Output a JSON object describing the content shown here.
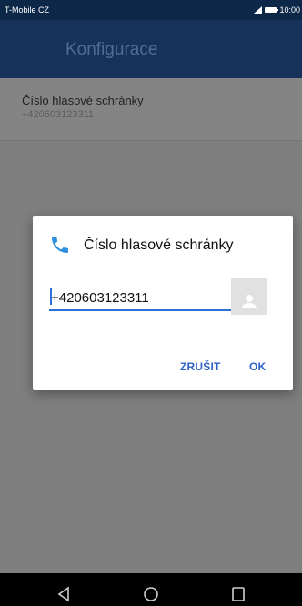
{
  "status_bar": {
    "carrier": "T-Mobile CZ",
    "time": "10:00",
    "icons": [
      "signal-icon",
      "battery-icon"
    ]
  },
  "app_bar": {
    "title": "Konfigurace"
  },
  "list": {
    "items": [
      {
        "title": "Číslo hlasové schránky",
        "subtitle": "+420603123311"
      }
    ]
  },
  "dialog": {
    "title": "Číslo hlasové schránky",
    "icon": "phone-icon",
    "input_value": "+420603123311",
    "contact_icon": "contact-icon",
    "cancel_label": "ZRUŠIT",
    "ok_label": "OK"
  },
  "nav_bar": {
    "icons": [
      "back-icon",
      "home-icon",
      "recents-icon"
    ]
  },
  "colors": {
    "status_bar": "#0d2748",
    "app_bar": "#16325a",
    "accent": "#2f62c8",
    "phone_icon": "#2f8fe0"
  }
}
